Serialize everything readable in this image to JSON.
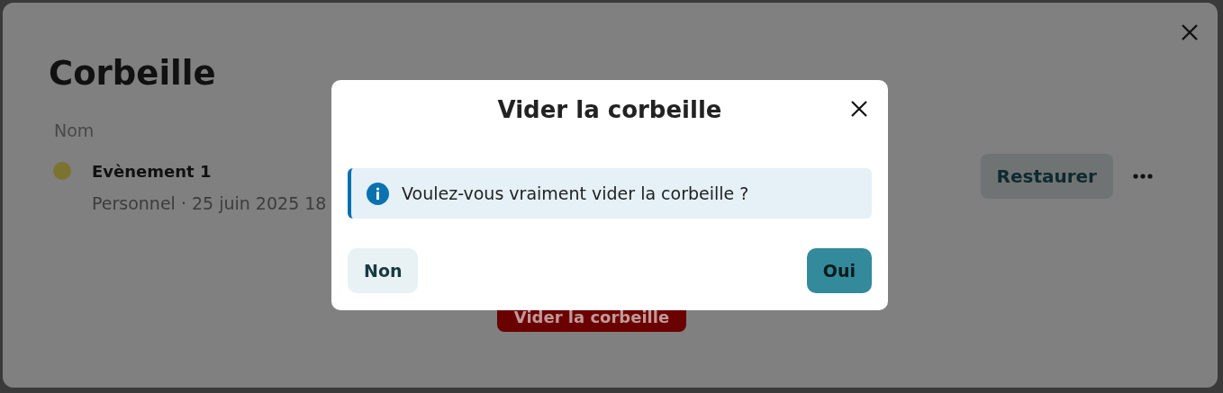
{
  "page": {
    "title": "Corbeille",
    "column_header": "Nom",
    "items": [
      {
        "name": "Evènement 1",
        "details": "Personnel · 25 juin 2025 18",
        "color": "#7d7330",
        "action": "Restaurer"
      }
    ],
    "empty_button": "Vider la corbeille"
  },
  "dialog": {
    "title": "Vider la corbeille",
    "message": "Voulez-vous vraiment vider la corbeille ?",
    "buttons": [
      {
        "label": "Non",
        "kind": "secondary"
      },
      {
        "label": "Oui",
        "kind": "primary"
      }
    ]
  }
}
